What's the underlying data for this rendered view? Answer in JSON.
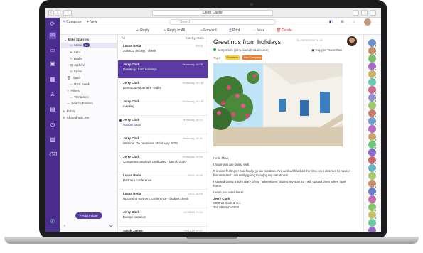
{
  "browser": {
    "url": "Deep Castle",
    "back": "‹",
    "forward": "›"
  },
  "toolbar": {
    "compose": "Compose",
    "new": "+ New",
    "search_placeholder": "Search"
  },
  "actions": {
    "reply": "Reply",
    "reply_all": "Reply to All",
    "forward": "Forward",
    "print": "Print",
    "more": "More",
    "delete": "Delete"
  },
  "folders": {
    "account": "Mike Sparrow",
    "inbox": "Inbox",
    "inbox_count": "12",
    "sent": "Sent",
    "drafts": "Drafts",
    "archive": "Archive",
    "spam": "Spam",
    "trash": "Trash",
    "rss": "RSS Feeds",
    "filters": "Filters",
    "templates": "Templates",
    "search_folders": "Search Folders",
    "public": "Public",
    "shared": "Shared with me",
    "add_folder": "+ Add Folder"
  },
  "list": {
    "filter": "All",
    "sort": "Sort by: Date",
    "messages": [
      {
        "from": "Lucas Beda",
        "date": "09:03",
        "subject": "2030/22 pricing - check",
        "selected": false,
        "unread": false
      },
      {
        "from": "Jerry Clark",
        "date": "Yesterday 16:28",
        "subject": "Greetings from holidays",
        "selected": true,
        "unread": false
      },
      {
        "from": "Jerry Clark",
        "date": "Yesterday 16:18",
        "subject": "Demo questionnaire - edits",
        "selected": false,
        "unread": false
      },
      {
        "from": "Jerry Clark",
        "date": "Yesterday 16:16",
        "subject": "meeting",
        "selected": false,
        "unread": false
      },
      {
        "from": "Jerry Clark",
        "date": "Yesterday 16:14",
        "subject": "holiday bags",
        "selected": false,
        "unread": true
      },
      {
        "from": "Jerry Clark",
        "date": "Yesterday 16:11",
        "subject": "Webinar On premises - February 2020",
        "selected": false,
        "unread": false
      },
      {
        "from": "Jerry Clark",
        "date": "Yesterday 16:09",
        "subject": "Competitor analysis Dedicated - March 2020",
        "selected": false,
        "unread": false
      },
      {
        "from": "Lucas Beda",
        "date": "02/02 15:48",
        "subject": "Partners conference",
        "selected": false,
        "unread": false
      },
      {
        "from": "Lucas Beda",
        "date": "02/02 14:05",
        "subject": "Upcoming partners conference - budget check",
        "selected": false,
        "unread": false
      },
      {
        "from": "Jerry Clark",
        "date": "02/22/19 13:24",
        "subject": "Europe vacation",
        "selected": false,
        "unread": false
      },
      {
        "from": "Sarah James",
        "date": "04/11/19 14:47",
        "subject": "",
        "selected": false,
        "unread": false
      }
    ]
  },
  "reader": {
    "subject": "Greetings from holidays",
    "date": "Tu 03/03/2020 16:28",
    "from": "Jerry Clark (jerry.clark@m1abs.com)",
    "copy": "Copy to TeamChat",
    "tags_label": "Tags:",
    "tags": [
      "Business",
      "Hot Company"
    ],
    "body": [
      "Hello Mike,",
      "I hope you are doing well.",
      "It is nice feelings I can finally go on vacation. I've worked hard all the time, so I deserve to have a fun time and I am really going to enjoy my vacations!",
      "I started doing a light diary of my \"adventures\" during my stay so I will upload them when I get home.",
      "I wish you were here!",
      "Jerry Clark",
      "CEO at Clark & Co.",
      "Tel: 808-542-6552"
    ]
  },
  "colors": {
    "brand": "#4a2d8f",
    "selected": "#5b3aa3",
    "online": "#2e9f4b",
    "tag_business": "#f5d23c",
    "tag_hot": "#ef7d2c"
  }
}
